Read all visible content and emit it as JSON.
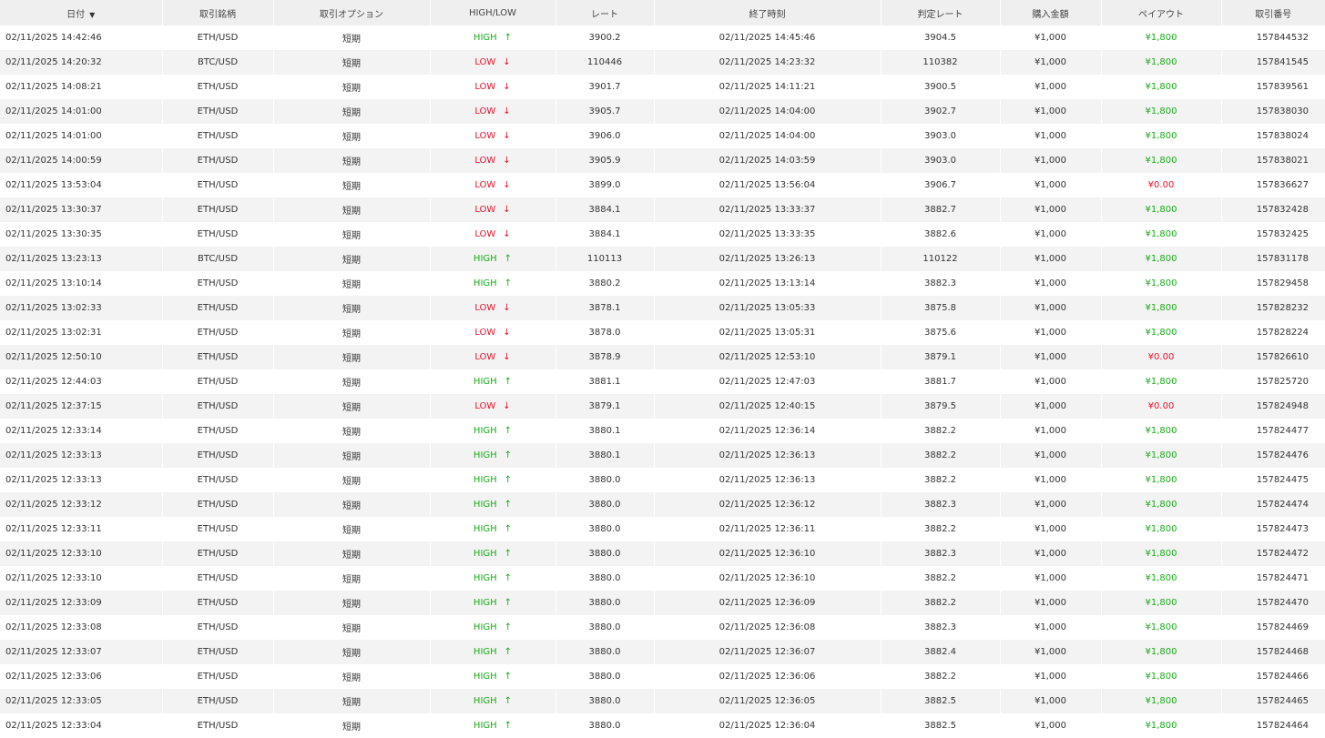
{
  "headers": {
    "date": "日付",
    "symbol": "取引銘柄",
    "option": "取引オプション",
    "direction": "HIGH/LOW",
    "rate": "レート",
    "expiry": "終了時刻",
    "judged": "判定レート",
    "amount": "購入金額",
    "payout": "ペイアウト",
    "trade_id": "取引番号"
  },
  "icons": {
    "sort": "sort-down-icon",
    "up": "arrow-up-icon",
    "down": "arrow-down-icon"
  },
  "colors": {
    "high": "#1aab1a",
    "low": "#e3152f",
    "header_bg": "#efefef",
    "stripe": "#f3f3f3"
  },
  "rows": [
    {
      "date": "02/11/2025 14:42:46",
      "symbol": "ETH/USD",
      "option": "短期",
      "direction": "HIGH",
      "rate": "3900.2",
      "expiry": "02/11/2025 14:45:46",
      "judged": "3904.5",
      "amount": "¥1,000",
      "payout": "¥1,800",
      "trade_id": "157844532"
    },
    {
      "date": "02/11/2025 14:20:32",
      "symbol": "BTC/USD",
      "option": "短期",
      "direction": "LOW",
      "rate": "110446",
      "expiry": "02/11/2025 14:23:32",
      "judged": "110382",
      "amount": "¥1,000",
      "payout": "¥1,800",
      "trade_id": "157841545"
    },
    {
      "date": "02/11/2025 14:08:21",
      "symbol": "ETH/USD",
      "option": "短期",
      "direction": "LOW",
      "rate": "3901.7",
      "expiry": "02/11/2025 14:11:21",
      "judged": "3900.5",
      "amount": "¥1,000",
      "payout": "¥1,800",
      "trade_id": "157839561"
    },
    {
      "date": "02/11/2025 14:01:00",
      "symbol": "ETH/USD",
      "option": "短期",
      "direction": "LOW",
      "rate": "3905.7",
      "expiry": "02/11/2025 14:04:00",
      "judged": "3902.7",
      "amount": "¥1,000",
      "payout": "¥1,800",
      "trade_id": "157838030"
    },
    {
      "date": "02/11/2025 14:01:00",
      "symbol": "ETH/USD",
      "option": "短期",
      "direction": "LOW",
      "rate": "3906.0",
      "expiry": "02/11/2025 14:04:00",
      "judged": "3903.0",
      "amount": "¥1,000",
      "payout": "¥1,800",
      "trade_id": "157838024"
    },
    {
      "date": "02/11/2025 14:00:59",
      "symbol": "ETH/USD",
      "option": "短期",
      "direction": "LOW",
      "rate": "3905.9",
      "expiry": "02/11/2025 14:03:59",
      "judged": "3903.0",
      "amount": "¥1,000",
      "payout": "¥1,800",
      "trade_id": "157838021"
    },
    {
      "date": "02/11/2025 13:53:04",
      "symbol": "ETH/USD",
      "option": "短期",
      "direction": "LOW",
      "rate": "3899.0",
      "expiry": "02/11/2025 13:56:04",
      "judged": "3906.7",
      "amount": "¥1,000",
      "payout": "¥0.00",
      "trade_id": "157836627"
    },
    {
      "date": "02/11/2025 13:30:37",
      "symbol": "ETH/USD",
      "option": "短期",
      "direction": "LOW",
      "rate": "3884.1",
      "expiry": "02/11/2025 13:33:37",
      "judged": "3882.7",
      "amount": "¥1,000",
      "payout": "¥1,800",
      "trade_id": "157832428"
    },
    {
      "date": "02/11/2025 13:30:35",
      "symbol": "ETH/USD",
      "option": "短期",
      "direction": "LOW",
      "rate": "3884.1",
      "expiry": "02/11/2025 13:33:35",
      "judged": "3882.6",
      "amount": "¥1,000",
      "payout": "¥1,800",
      "trade_id": "157832425"
    },
    {
      "date": "02/11/2025 13:23:13",
      "symbol": "BTC/USD",
      "option": "短期",
      "direction": "HIGH",
      "rate": "110113",
      "expiry": "02/11/2025 13:26:13",
      "judged": "110122",
      "amount": "¥1,000",
      "payout": "¥1,800",
      "trade_id": "157831178"
    },
    {
      "date": "02/11/2025 13:10:14",
      "symbol": "ETH/USD",
      "option": "短期",
      "direction": "HIGH",
      "rate": "3880.2",
      "expiry": "02/11/2025 13:13:14",
      "judged": "3882.3",
      "amount": "¥1,000",
      "payout": "¥1,800",
      "trade_id": "157829458"
    },
    {
      "date": "02/11/2025 13:02:33",
      "symbol": "ETH/USD",
      "option": "短期",
      "direction": "LOW",
      "rate": "3878.1",
      "expiry": "02/11/2025 13:05:33",
      "judged": "3875.8",
      "amount": "¥1,000",
      "payout": "¥1,800",
      "trade_id": "157828232"
    },
    {
      "date": "02/11/2025 13:02:31",
      "symbol": "ETH/USD",
      "option": "短期",
      "direction": "LOW",
      "rate": "3878.0",
      "expiry": "02/11/2025 13:05:31",
      "judged": "3875.6",
      "amount": "¥1,000",
      "payout": "¥1,800",
      "trade_id": "157828224"
    },
    {
      "date": "02/11/2025 12:50:10",
      "symbol": "ETH/USD",
      "option": "短期",
      "direction": "LOW",
      "rate": "3878.9",
      "expiry": "02/11/2025 12:53:10",
      "judged": "3879.1",
      "amount": "¥1,000",
      "payout": "¥0.00",
      "trade_id": "157826610"
    },
    {
      "date": "02/11/2025 12:44:03",
      "symbol": "ETH/USD",
      "option": "短期",
      "direction": "HIGH",
      "rate": "3881.1",
      "expiry": "02/11/2025 12:47:03",
      "judged": "3881.7",
      "amount": "¥1,000",
      "payout": "¥1,800",
      "trade_id": "157825720"
    },
    {
      "date": "02/11/2025 12:37:15",
      "symbol": "ETH/USD",
      "option": "短期",
      "direction": "LOW",
      "rate": "3879.1",
      "expiry": "02/11/2025 12:40:15",
      "judged": "3879.5",
      "amount": "¥1,000",
      "payout": "¥0.00",
      "trade_id": "157824948"
    },
    {
      "date": "02/11/2025 12:33:14",
      "symbol": "ETH/USD",
      "option": "短期",
      "direction": "HIGH",
      "rate": "3880.1",
      "expiry": "02/11/2025 12:36:14",
      "judged": "3882.2",
      "amount": "¥1,000",
      "payout": "¥1,800",
      "trade_id": "157824477"
    },
    {
      "date": "02/11/2025 12:33:13",
      "symbol": "ETH/USD",
      "option": "短期",
      "direction": "HIGH",
      "rate": "3880.1",
      "expiry": "02/11/2025 12:36:13",
      "judged": "3882.2",
      "amount": "¥1,000",
      "payout": "¥1,800",
      "trade_id": "157824476"
    },
    {
      "date": "02/11/2025 12:33:13",
      "symbol": "ETH/USD",
      "option": "短期",
      "direction": "HIGH",
      "rate": "3880.0",
      "expiry": "02/11/2025 12:36:13",
      "judged": "3882.2",
      "amount": "¥1,000",
      "payout": "¥1,800",
      "trade_id": "157824475"
    },
    {
      "date": "02/11/2025 12:33:12",
      "symbol": "ETH/USD",
      "option": "短期",
      "direction": "HIGH",
      "rate": "3880.0",
      "expiry": "02/11/2025 12:36:12",
      "judged": "3882.3",
      "amount": "¥1,000",
      "payout": "¥1,800",
      "trade_id": "157824474"
    },
    {
      "date": "02/11/2025 12:33:11",
      "symbol": "ETH/USD",
      "option": "短期",
      "direction": "HIGH",
      "rate": "3880.0",
      "expiry": "02/11/2025 12:36:11",
      "judged": "3882.2",
      "amount": "¥1,000",
      "payout": "¥1,800",
      "trade_id": "157824473"
    },
    {
      "date": "02/11/2025 12:33:10",
      "symbol": "ETH/USD",
      "option": "短期",
      "direction": "HIGH",
      "rate": "3880.0",
      "expiry": "02/11/2025 12:36:10",
      "judged": "3882.3",
      "amount": "¥1,000",
      "payout": "¥1,800",
      "trade_id": "157824472"
    },
    {
      "date": "02/11/2025 12:33:10",
      "symbol": "ETH/USD",
      "option": "短期",
      "direction": "HIGH",
      "rate": "3880.0",
      "expiry": "02/11/2025 12:36:10",
      "judged": "3882.2",
      "amount": "¥1,000",
      "payout": "¥1,800",
      "trade_id": "157824471"
    },
    {
      "date": "02/11/2025 12:33:09",
      "symbol": "ETH/USD",
      "option": "短期",
      "direction": "HIGH",
      "rate": "3880.0",
      "expiry": "02/11/2025 12:36:09",
      "judged": "3882.2",
      "amount": "¥1,000",
      "payout": "¥1,800",
      "trade_id": "157824470"
    },
    {
      "date": "02/11/2025 12:33:08",
      "symbol": "ETH/USD",
      "option": "短期",
      "direction": "HIGH",
      "rate": "3880.0",
      "expiry": "02/11/2025 12:36:08",
      "judged": "3882.3",
      "amount": "¥1,000",
      "payout": "¥1,800",
      "trade_id": "157824469"
    },
    {
      "date": "02/11/2025 12:33:07",
      "symbol": "ETH/USD",
      "option": "短期",
      "direction": "HIGH",
      "rate": "3880.0",
      "expiry": "02/11/2025 12:36:07",
      "judged": "3882.4",
      "amount": "¥1,000",
      "payout": "¥1,800",
      "trade_id": "157824468"
    },
    {
      "date": "02/11/2025 12:33:06",
      "symbol": "ETH/USD",
      "option": "短期",
      "direction": "HIGH",
      "rate": "3880.0",
      "expiry": "02/11/2025 12:36:06",
      "judged": "3882.2",
      "amount": "¥1,000",
      "payout": "¥1,800",
      "trade_id": "157824466"
    },
    {
      "date": "02/11/2025 12:33:05",
      "symbol": "ETH/USD",
      "option": "短期",
      "direction": "HIGH",
      "rate": "3880.0",
      "expiry": "02/11/2025 12:36:05",
      "judged": "3882.5",
      "amount": "¥1,000",
      "payout": "¥1,800",
      "trade_id": "157824465"
    },
    {
      "date": "02/11/2025 12:33:04",
      "symbol": "ETH/USD",
      "option": "短期",
      "direction": "HIGH",
      "rate": "3880.0",
      "expiry": "02/11/2025 12:36:04",
      "judged": "3882.5",
      "amount": "¥1,000",
      "payout": "¥1,800",
      "trade_id": "157824464"
    }
  ]
}
